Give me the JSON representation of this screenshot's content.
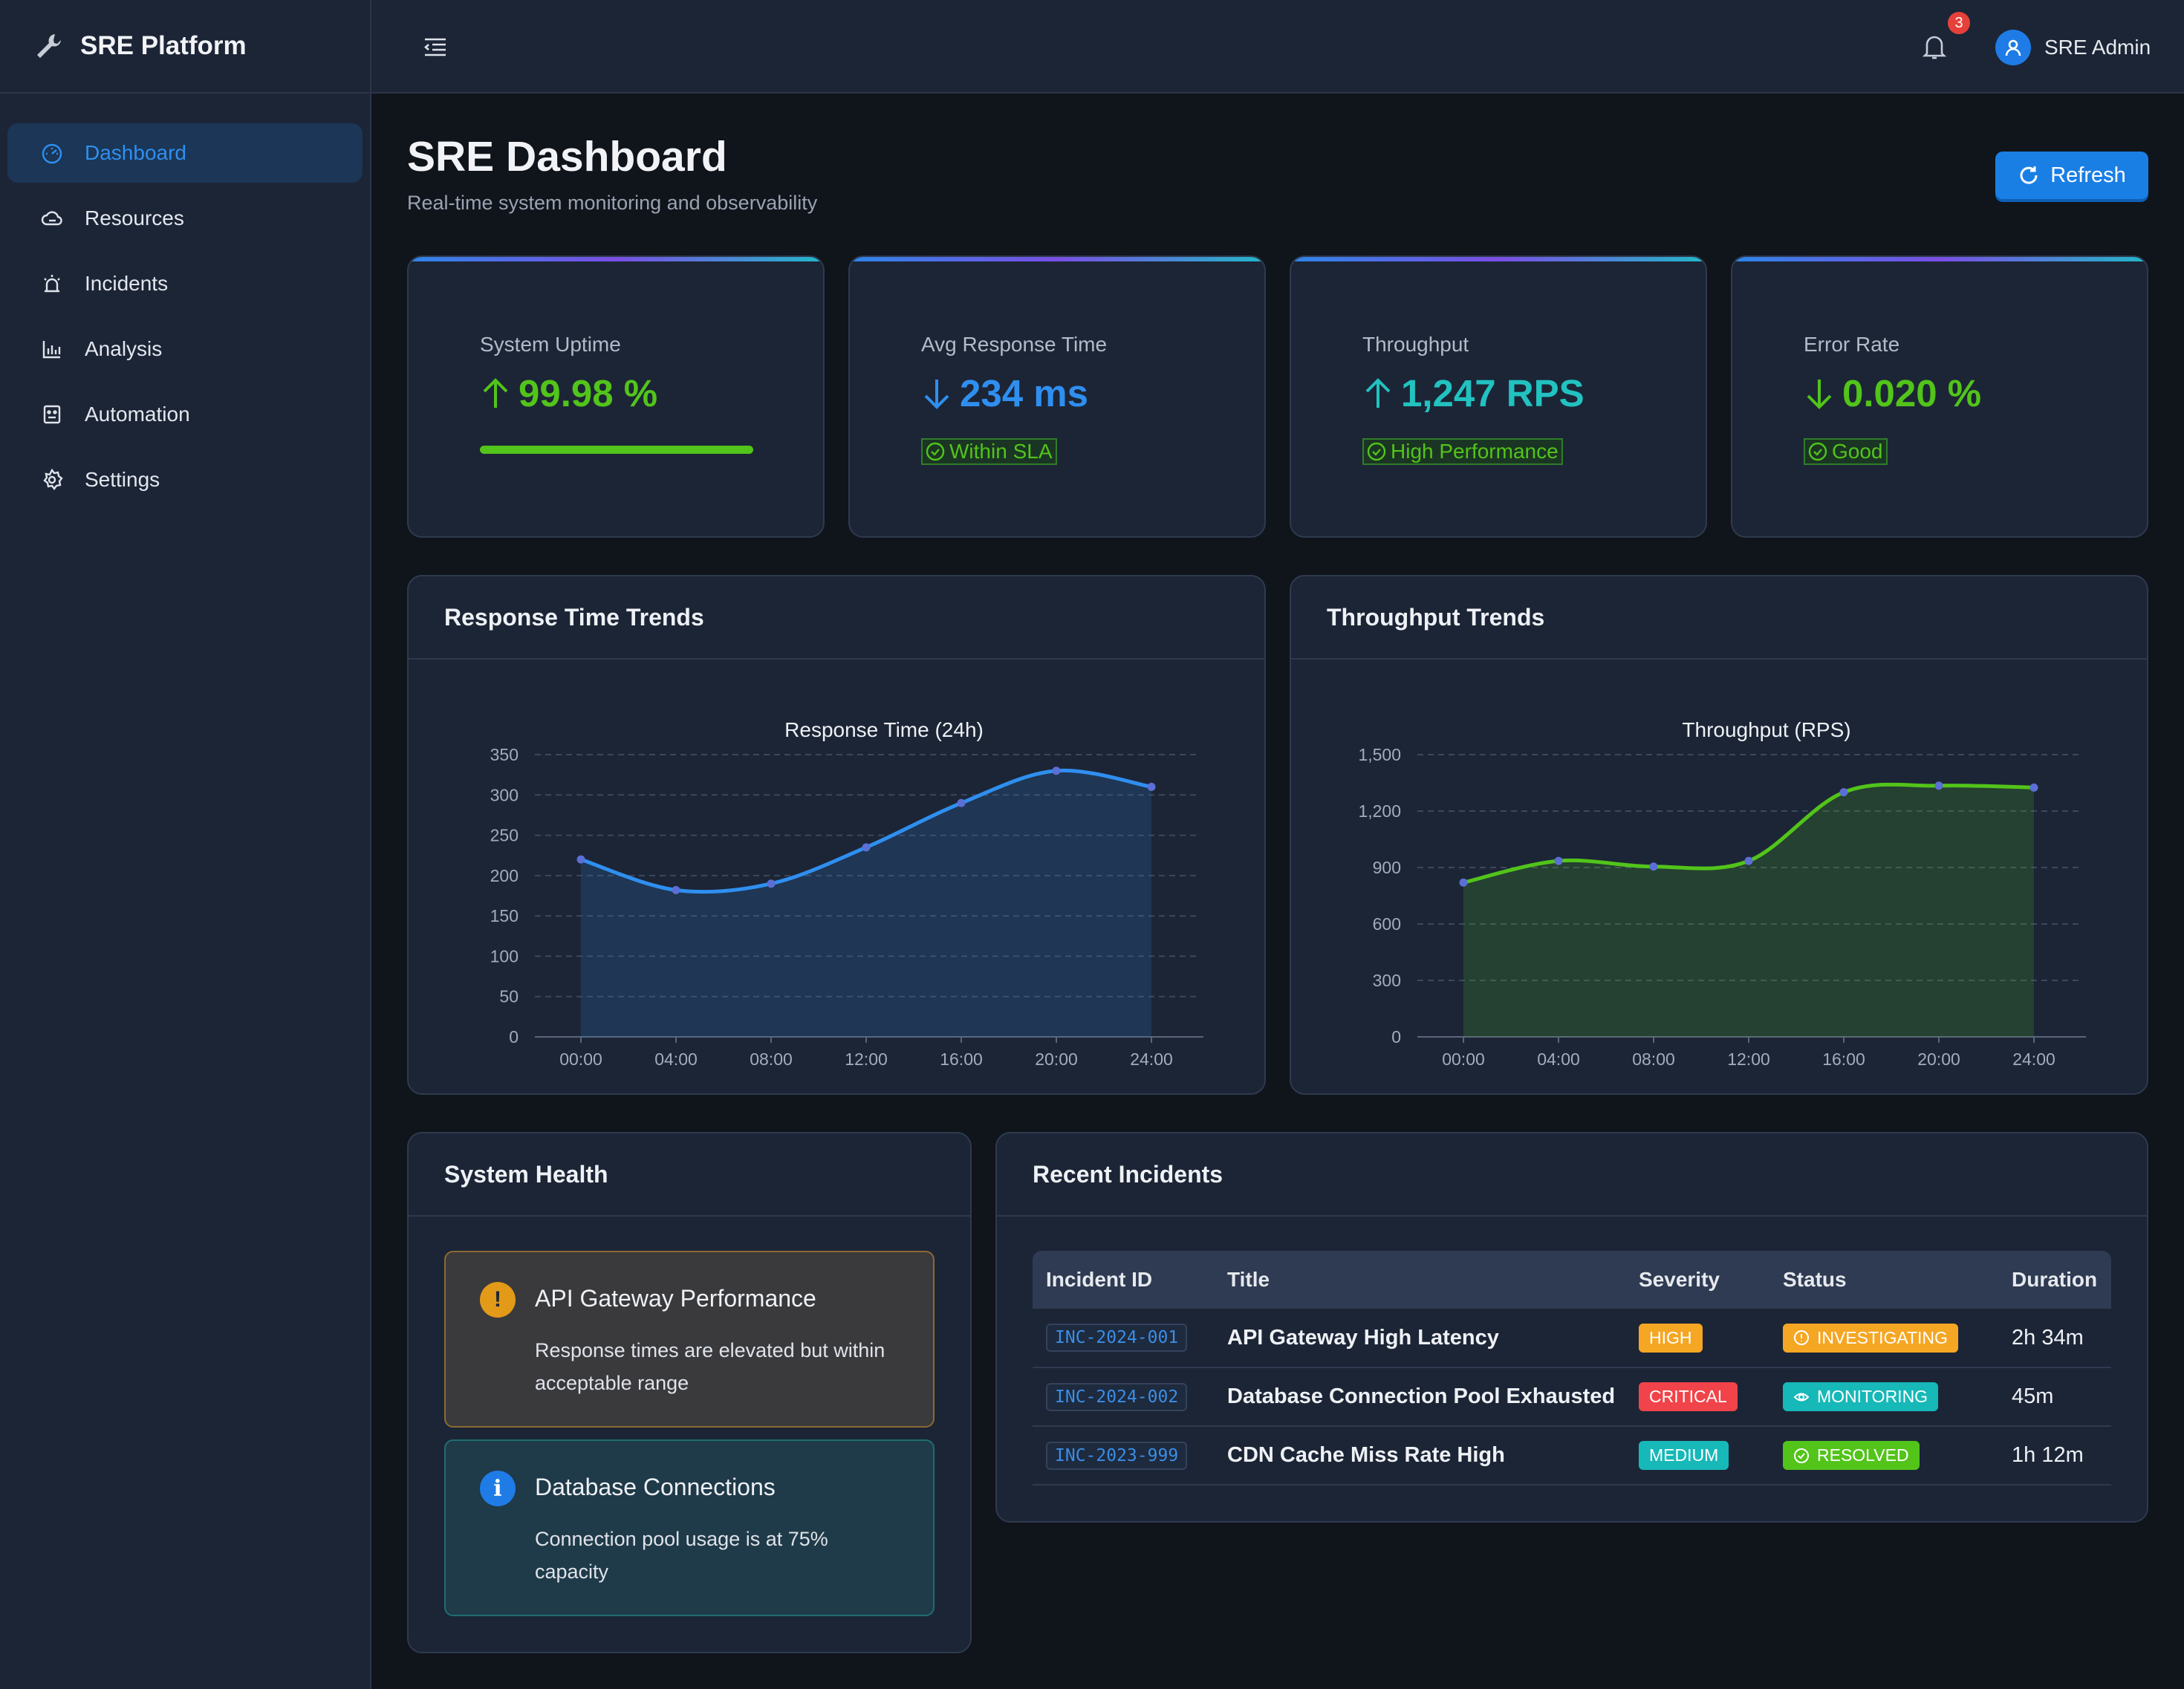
{
  "brand": {
    "title": "SRE Platform",
    "icon": "wrench-icon"
  },
  "sidebar": {
    "items": [
      {
        "label": "Dashboard",
        "icon": "dashboard-icon",
        "active": true
      },
      {
        "label": "Resources",
        "icon": "cloud-icon"
      },
      {
        "label": "Incidents",
        "icon": "alarm-icon"
      },
      {
        "label": "Analysis",
        "icon": "bar-chart-icon"
      },
      {
        "label": "Automation",
        "icon": "robot-icon"
      },
      {
        "label": "Settings",
        "icon": "gear-icon"
      }
    ]
  },
  "topbar": {
    "notifications": "3",
    "user": "SRE Admin"
  },
  "header": {
    "title": "SRE Dashboard",
    "subtitle": "Real-time system monitoring and observability",
    "refresh": "Refresh"
  },
  "kpis": [
    {
      "label": "System Uptime",
      "value": "99.98 %",
      "trend": "up",
      "color": "#52c41a",
      "progress": 1.0
    },
    {
      "label": "Avg Response Time",
      "value": "234 ms",
      "trend": "down",
      "color": "#2f8ff0",
      "tag": "Within SLA"
    },
    {
      "label": "Throughput",
      "value": "1,247 RPS",
      "trend": "up",
      "color": "#21c2c0",
      "tag": "High Performance"
    },
    {
      "label": "Error Rate",
      "value": "0.020 %",
      "trend": "down",
      "color": "#52c41a",
      "tag": "Good"
    }
  ],
  "charts": {
    "response_panel_title": "Response Time Trends",
    "throughput_panel_title": "Throughput Trends"
  },
  "chart_data": [
    {
      "type": "line",
      "title": "Response Time (24h)",
      "x": [
        "00:00",
        "04:00",
        "08:00",
        "12:00",
        "16:00",
        "20:00",
        "24:00"
      ],
      "values": [
        220,
        182,
        190,
        235,
        290,
        330,
        310
      ],
      "ylim": [
        0,
        350
      ],
      "yticks": [
        "0",
        "50",
        "100",
        "150",
        "200",
        "250",
        "300",
        "350"
      ],
      "color": "#2f8ff0",
      "area": true,
      "grid": true
    },
    {
      "type": "line",
      "title": "Throughput (RPS)",
      "x": [
        "00:00",
        "04:00",
        "08:00",
        "12:00",
        "16:00",
        "20:00",
        "24:00"
      ],
      "values": [
        820,
        935,
        905,
        935,
        1300,
        1335,
        1325
      ],
      "ylim": [
        0,
        1500
      ],
      "yticks": [
        "0",
        "300",
        "600",
        "900",
        "1,200",
        "1,500"
      ],
      "color": "#52c41a",
      "area": true,
      "grid": true
    }
  ],
  "health": {
    "title": "System Health",
    "alerts": [
      {
        "title": "API Gateway Performance",
        "text": "Response times are elevated but within acceptable range",
        "icon": "warning-icon"
      },
      {
        "title": "Database Connections",
        "text": "Connection pool usage is at 75% capacity",
        "icon": "info-icon"
      }
    ]
  },
  "incidents": {
    "title": "Recent Incidents",
    "columns": [
      "Incident ID",
      "Title",
      "Severity",
      "Status",
      "Duration"
    ],
    "rows": [
      {
        "id": "INC-2024-001",
        "title": "API Gateway High Latency",
        "severity": "HIGH",
        "severity_color": "#f5a623",
        "status": "INVESTIGATING",
        "status_color": "#f5a623",
        "status_icon": "alert-circle-icon",
        "duration": "2h 34m"
      },
      {
        "id": "INC-2024-002",
        "title": "Database Connection Pool Exhausted",
        "severity": "CRITICAL",
        "severity_color": "#f0444a",
        "status": "MONITORING",
        "status_color": "#17b8b8",
        "status_icon": "eye-icon",
        "duration": "45m"
      },
      {
        "id": "INC-2023-999",
        "title": "CDN Cache Miss Rate High",
        "severity": "MEDIUM",
        "severity_color": "#17b8b8",
        "status": "RESOLVED",
        "status_color": "#52c41a",
        "status_icon": "check-circle-icon",
        "duration": "1h 12m"
      }
    ]
  }
}
